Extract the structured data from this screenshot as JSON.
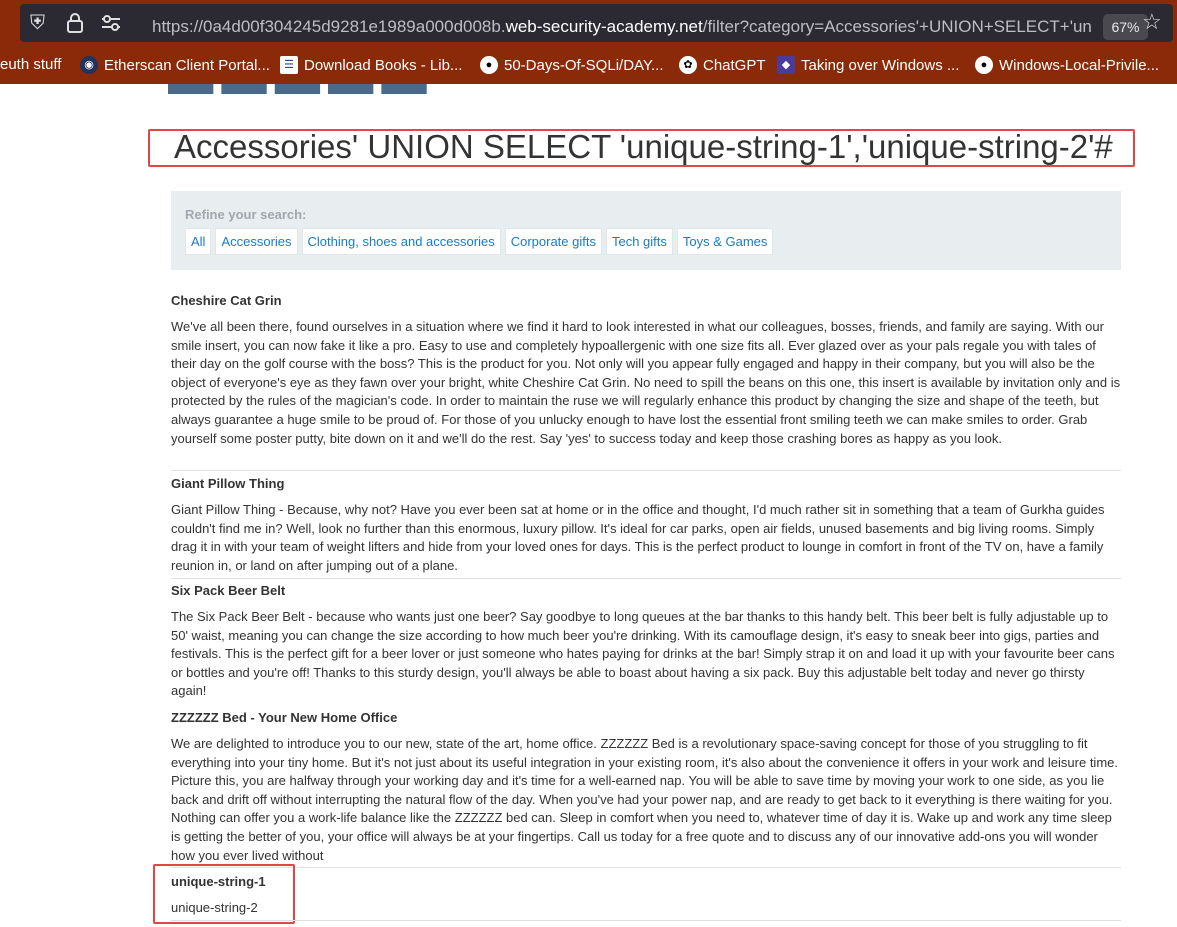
{
  "browser": {
    "url_prefix": "https://0a4d00f304245d9281e1989a000d008b.",
    "url_domain": "web-security-academy.net",
    "url_path": "/filter?category=Accessories'+UNION+SELECT+'un",
    "zoom": "67%",
    "bookmarks": [
      {
        "label": "euth stuff"
      },
      {
        "label": "Etherscan Client Portal..."
      },
      {
        "label": "Download Books - Lib..."
      },
      {
        "label": "50-Days-Of-SQLi/DAY..."
      },
      {
        "label": "ChatGPT"
      },
      {
        "label": "Taking over Windows ..."
      },
      {
        "label": "Windows-Local-Privile..."
      }
    ]
  },
  "page": {
    "heading": "Accessories' UNION SELECT 'unique-string-1','unique-string-2'#",
    "refine_label": "Refine your search:",
    "filters": [
      "All",
      "Accessories",
      "Clothing, shoes and accessories",
      "Corporate gifts",
      "Tech gifts",
      "Toys & Games"
    ],
    "products": [
      {
        "name": "Cheshire Cat Grin",
        "description": "We've all been there, found ourselves in a situation where we find it hard to look interested in what our colleagues, bosses, friends, and family are saying. With our smile insert, you can now fake it like a pro. Easy to use and completely hypoallergenic with one size fits all. Ever glazed over as your pals regale you with tales of their day on the golf course with the boss? This is the product for you. Not only will you appear fully engaged and happy in their company, but you will also be the object of everyone's eye as they fawn over your bright, white Cheshire Cat Grin. No need to spill the beans on this one, this insert is available by invitation only and is protected by the rules of the magician's code. In order to maintain the ruse we will regularly enhance this product by changing the size and shape of the teeth, but always guarantee a huge smile to be proud of. For those of you unlucky enough to have lost the essential front smiling teeth we can make smiles to order. Grab yourself some poster putty, bite down on it and we'll do the rest. Say 'yes' to success today and keep those crashing bores as happy as you look."
      },
      {
        "name": "Giant Pillow Thing",
        "description": "Giant Pillow Thing - Because, why not? Have you ever been sat at home or in the office and thought, I'd much rather sit in something that a team of Gurkha guides couldn't find me in? Well, look no further than this enormous, luxury pillow. It's ideal for car parks, open air fields, unused basements and big living rooms. Simply drag it in with your team of weight lifters and hide from your loved ones for days. This is the perfect product to lounge in comfort in front of the TV on, have a family reunion in, or land on after jumping out of a plane."
      },
      {
        "name": "Six Pack Beer Belt",
        "description": "The Six Pack Beer Belt - because who wants just one beer? Say goodbye to long queues at the bar thanks to this handy belt. This beer belt is fully adjustable up to 50' waist, meaning you can change the size according to how much beer you're drinking. With its camouflage design, it's easy to sneak beer into gigs, parties and festivals. This is the perfect gift for a beer lover or just someone who hates paying for drinks at the bar! Simply strap it on and load it up with your favourite beer cans or bottles and you're off! Thanks to this sturdy design, you'll always be able to boast about having a six pack. Buy this adjustable belt today and never go thirsty again!"
      },
      {
        "name": "ZZZZZZ Bed - Your New Home Office",
        "description": "We are delighted to introduce you to our new, state of the art, home office. ZZZZZZ Bed is a revolutionary space-saving concept for those of you struggling to fit everything into your tiny home. But it's not just about its useful integration in your existing room, it's also about the convenience it offers in your work and leisure time. Picture this, you are halfway through your working day and it's time for a well-earned nap. You will be able to save time by moving your work to one side, as you lie back and drift off without interrupting the natural flow of the day. When you've had your power nap, and are ready to get back to it everything is there waiting for you. Nothing can offer you a work-life balance like the ZZZZZZ bed can. Sleep in comfort when you need to, whatever time of day it is. Wake up and work any time sleep is getting the better of you, your office will always be at your fingertips. Call us today for a free quote and to discuss any of our innovative add-ons you will wonder how you ever lived without"
      },
      {
        "name": "unique-string-1",
        "description": "unique-string-2"
      }
    ]
  },
  "colors": {
    "toolbar": "#8a2a08",
    "urlbar": "#2b2a33",
    "highlight": "#e04848",
    "link": "#1b7bbf"
  }
}
